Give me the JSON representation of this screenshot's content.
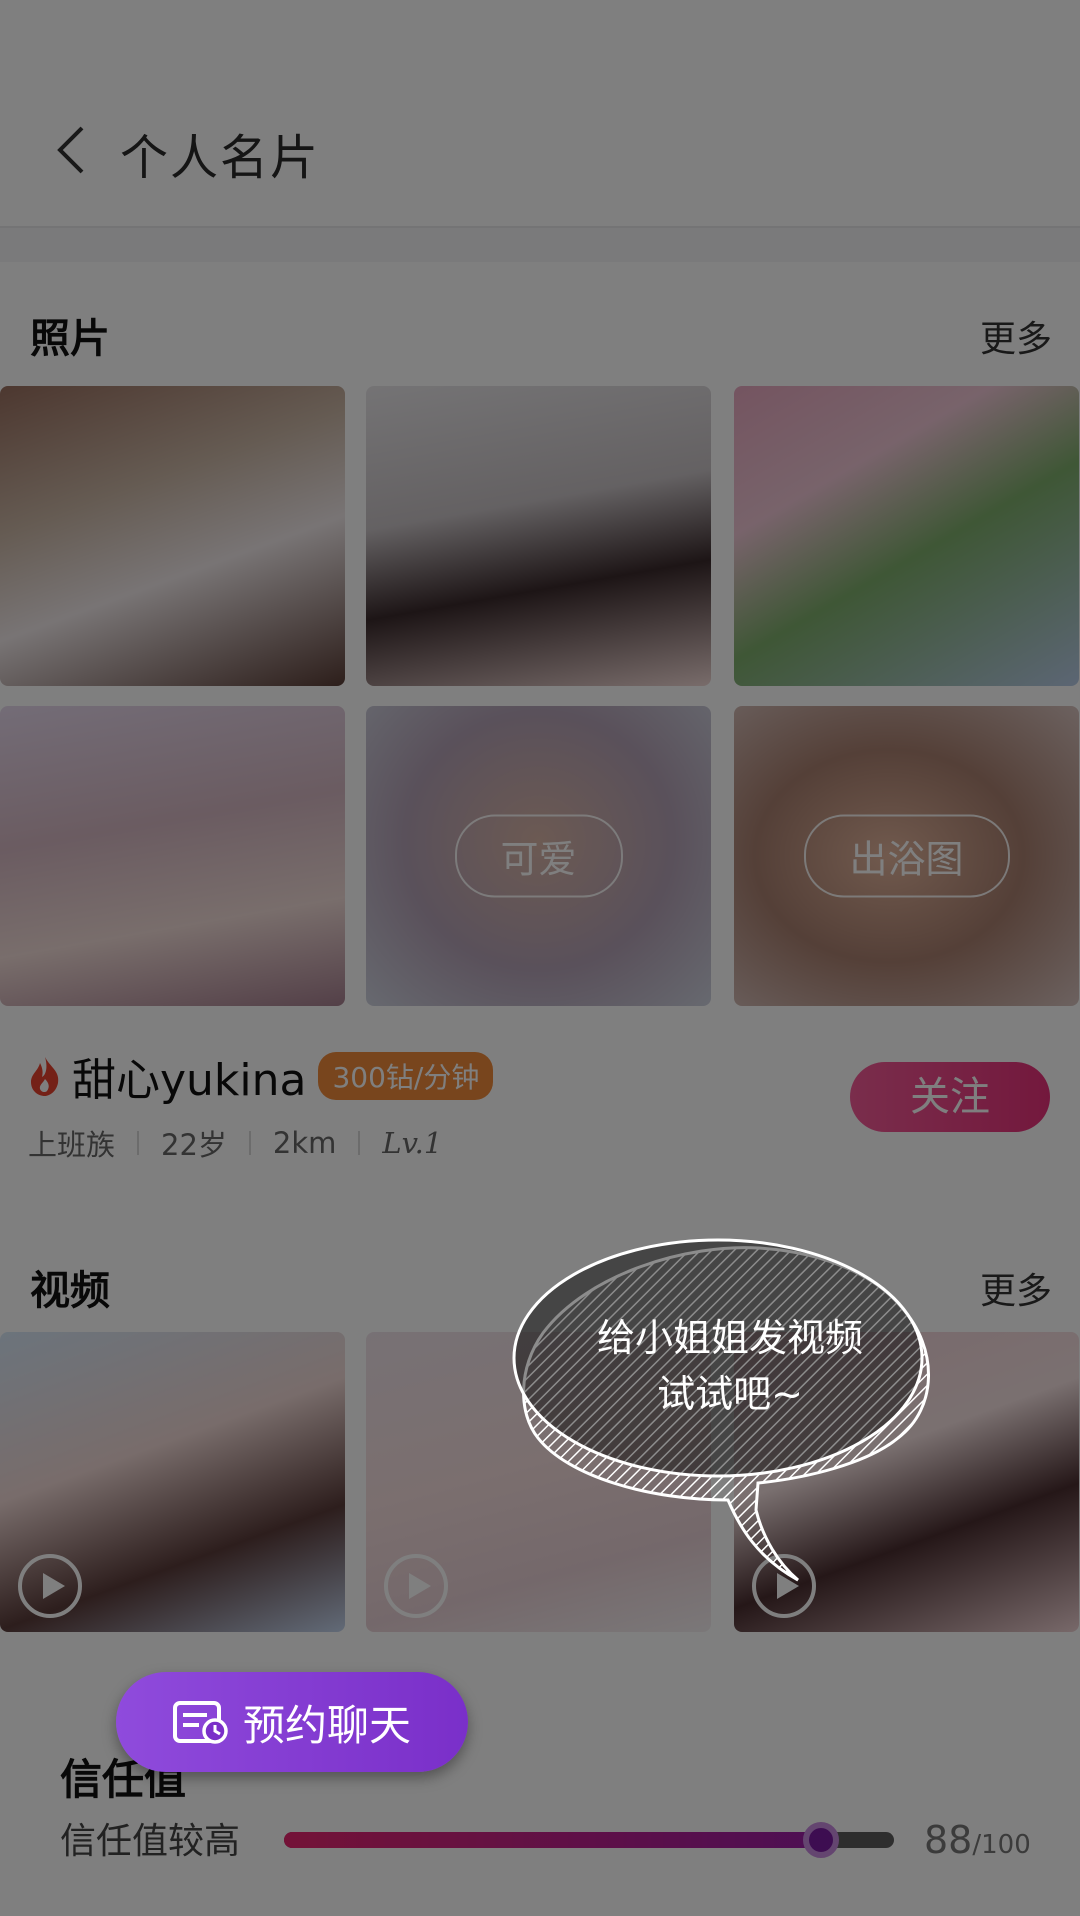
{
  "header": {
    "title": "个人名片",
    "back_icon": "chevron-left-icon"
  },
  "photos": {
    "title": "照片",
    "more": "更多",
    "locked_labels": [
      "可爱",
      "出浴图"
    ]
  },
  "profile": {
    "name": "甜心yukina",
    "price": "300钻/分钟",
    "tags": [
      "上班族",
      "22岁",
      "2km"
    ],
    "level": "Lv.1",
    "follow_label": "关注"
  },
  "videos": {
    "title": "视频",
    "more": "更多"
  },
  "trust": {
    "title": "信任值",
    "desc": "信任值较高",
    "score": 88,
    "score_value": "88",
    "score_max": "/100"
  },
  "bubble": {
    "line1": "给小姐姐发视频",
    "line2": "试试吧~"
  },
  "book_chat": {
    "label": "预约聊天"
  },
  "colors": {
    "accent_pink": "#e7317a",
    "purple": "#8f4bdc",
    "orange": "#f08a3a"
  }
}
